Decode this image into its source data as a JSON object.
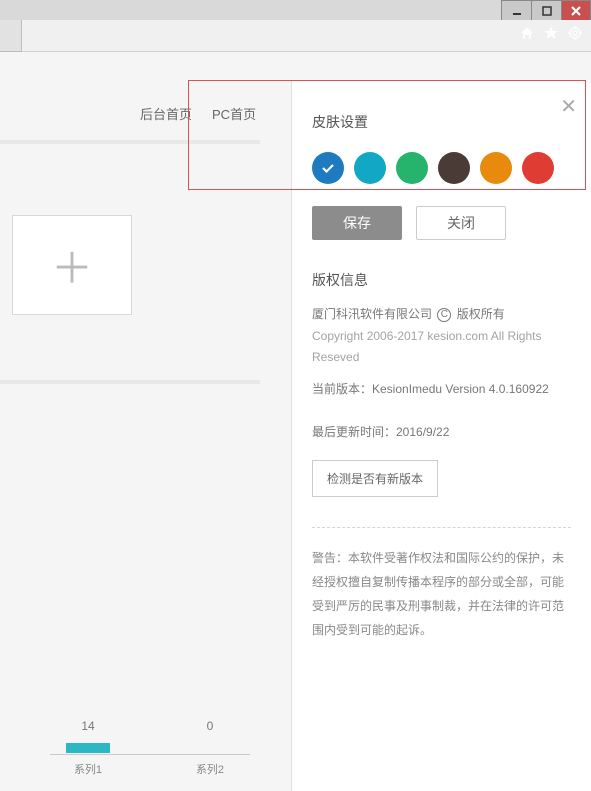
{
  "nav": {
    "backend_home": "后台首页",
    "pc_home": "PC首页"
  },
  "panel": {
    "title": "皮肤设置",
    "colors": [
      {
        "name": "blue",
        "hex": "#1e7bbf",
        "selected": true
      },
      {
        "name": "cyan",
        "hex": "#13a7c6",
        "selected": false
      },
      {
        "name": "green",
        "hex": "#26b36b",
        "selected": false
      },
      {
        "name": "brown",
        "hex": "#4a3b37",
        "selected": false
      },
      {
        "name": "orange",
        "hex": "#e78a0d",
        "selected": false
      },
      {
        "name": "red",
        "hex": "#df3d33",
        "selected": false
      }
    ],
    "save_label": "保存",
    "close_label": "关闭",
    "copyright_title": "版权信息",
    "company_line_a": "厦门科汛软件有限公司",
    "company_line_b": "版权所有",
    "copyright_en": "Copyright 2006-2017 kesion.com All Rights Reseved",
    "version_line": "当前版本：KesionImedu Version 4.0.160922",
    "update_line": "最后更新时间：2016/9/22",
    "detect_btn": "检测是否有新版本",
    "warning": "警告：本软件受著作权法和国际公约的保护，未经授权擅自复制传播本程序的部分或全部，可能受到严厉的民事及刑事制裁，并在法律的许可范围内受到可能的起诉。"
  },
  "chart_data": {
    "type": "bar",
    "categories": [
      "系列1",
      "系列2"
    ],
    "values": [
      14,
      0
    ],
    "title": "",
    "xlabel": "",
    "ylabel": "",
    "ylim": [
      0,
      20
    ]
  }
}
